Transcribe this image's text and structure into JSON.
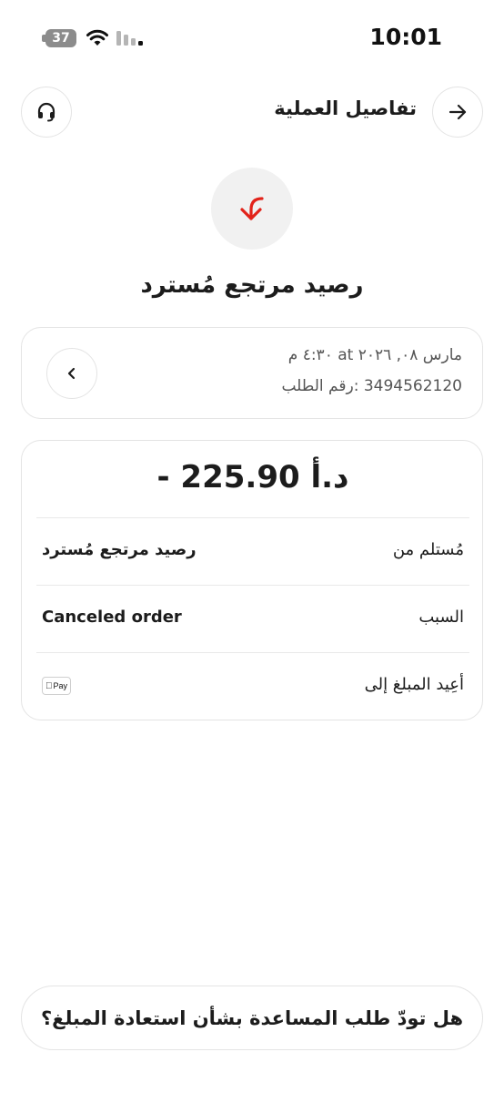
{
  "status_bar": {
    "time": "10:01",
    "battery": "37"
  },
  "header": {
    "title": "تفاصيل العملية"
  },
  "hero": {
    "title": "رصيد مرتجع مُسترد"
  },
  "order": {
    "date": "مارس ٠٨, ٢٠٢٦ at ٤:٣٠ م",
    "number": "3494562120 :رقم الطلب"
  },
  "details": {
    "amount": "- 225.90 د.أ",
    "rows": [
      {
        "label": "مُستلم من",
        "value": "رصيد مرتجع مُسترد"
      },
      {
        "label": "السبب",
        "value": "Canceled order"
      },
      {
        "label": "أعِيد المبلغ إلى",
        "value": "Pay"
      }
    ]
  },
  "help_button": {
    "label": "هل تودّ طلب المساعدة بشأن استعادة المبلغ؟"
  },
  "colors": {
    "accent_red": "#e2231a",
    "border": "#e4e4e4",
    "text": "#1c1c1c"
  },
  "icons": {
    "back": "arrow-right-icon",
    "support": "headset-icon",
    "refund": "return-arrow-icon",
    "chevron": "chevron-left-icon",
    "payment": "apple-pay-icon"
  }
}
